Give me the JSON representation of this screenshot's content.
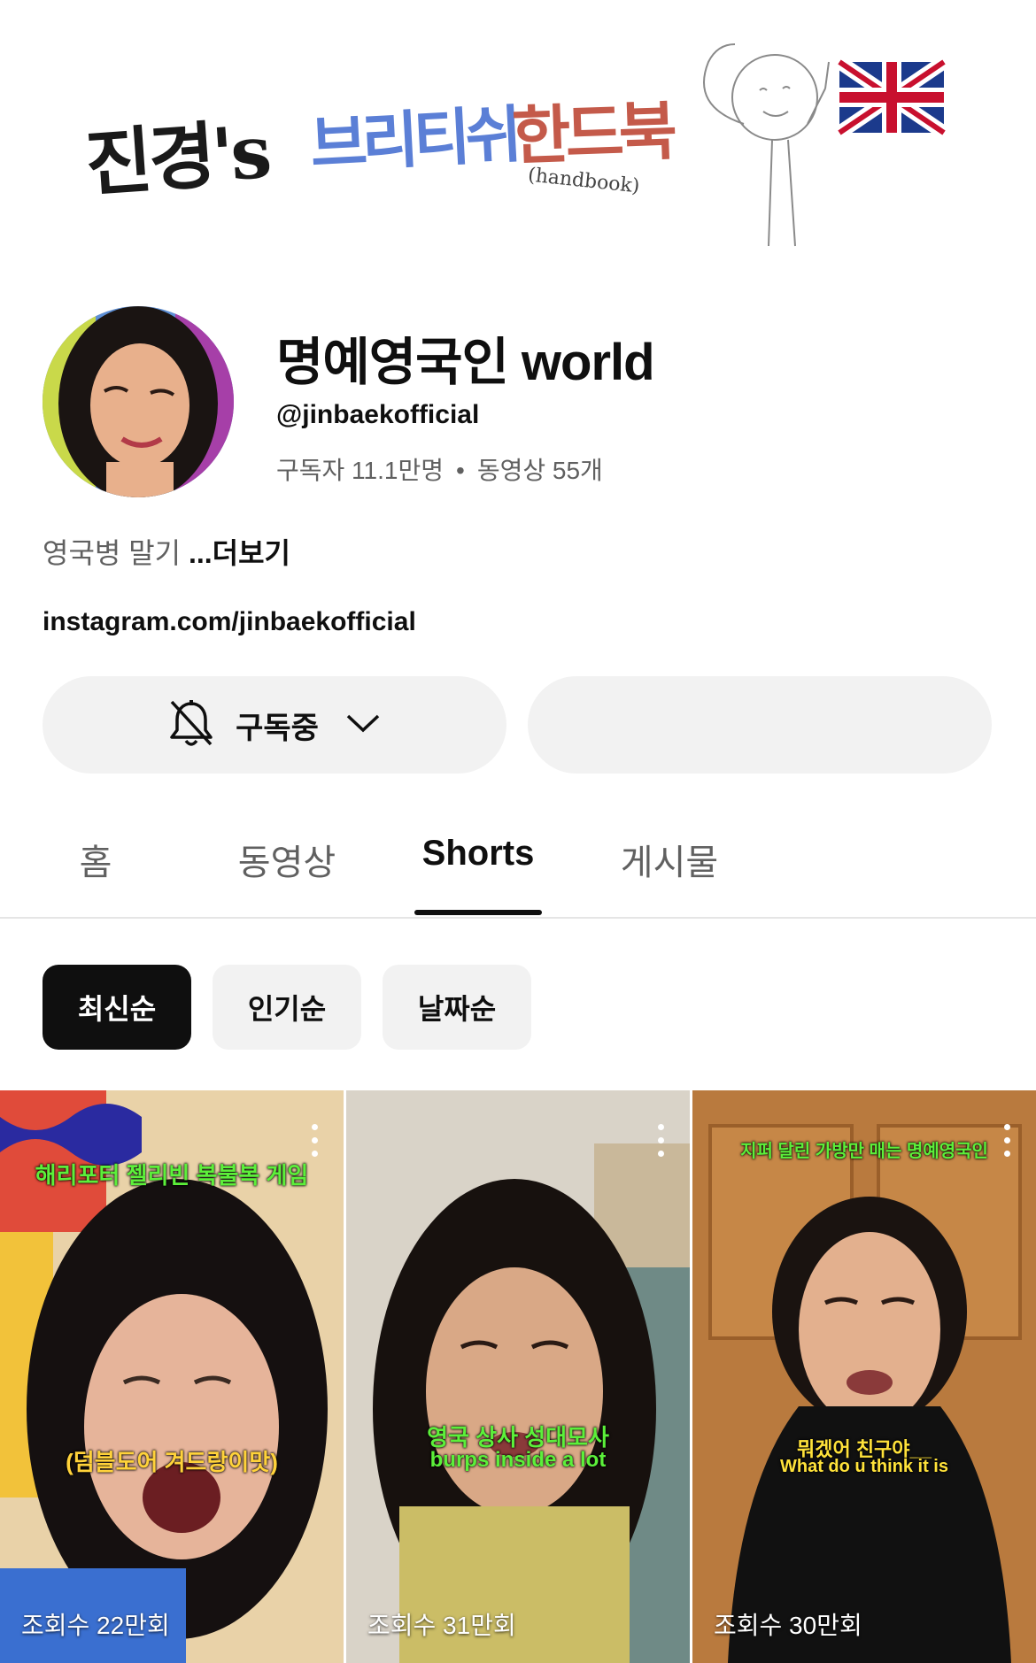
{
  "banner": {
    "title_part1": "진경's",
    "title_part2": "브리티쉬",
    "title_part3": "한드북",
    "subtitle": "(handbook)",
    "flag_icon": "uk-flag-icon"
  },
  "channel": {
    "name": "명예영국인 world",
    "handle": "@jinbaekofficial",
    "subscribers": "구독자 11.1만명",
    "videos": "동영상 55개",
    "description": "영국병 말기",
    "more_label": "...더보기",
    "link": "instagram.com/jinbaekofficial"
  },
  "buttons": {
    "subscribe_label": "구독중",
    "bell_icon": "bell-off-icon",
    "chevron_icon": "chevron-down-icon"
  },
  "tabs": [
    {
      "label": "홈"
    },
    {
      "label": "동영상"
    },
    {
      "label": "Shorts"
    },
    {
      "label": "게시물"
    }
  ],
  "active_tab": "Shorts",
  "chips": [
    {
      "label": "최신순"
    },
    {
      "label": "인기순"
    },
    {
      "label": "날짜순"
    }
  ],
  "active_chip": "최신순",
  "shorts": [
    {
      "caption_top": "해리포터 젤리빈 복불복 게임",
      "caption_bottom": "(덤블도어 겨드랑이맛)",
      "views": "조회수 22만회"
    },
    {
      "caption_top": "영국 상사 성대모사",
      "caption_bottom": "burps inside a lot",
      "views": "조회수 31만회"
    },
    {
      "caption_top": "지퍼 달린 가방만 매는 명예영국인",
      "caption_mid1": "뭐겠어 친구야__",
      "caption_mid2": "What do u think it is",
      "views": "조회수 30만회"
    }
  ],
  "colors": {
    "accent_caption": "#5cf03a",
    "chip_active": "#0f0f0f",
    "button_bg": "#f2f2f2"
  }
}
